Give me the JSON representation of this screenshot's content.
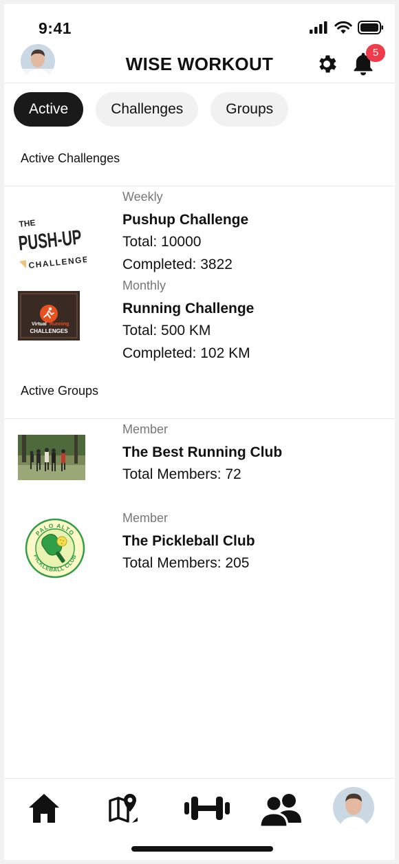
{
  "status_bar": {
    "time": "9:41"
  },
  "header": {
    "title": "WISE WORKOUT",
    "notification_count": "5"
  },
  "tabs": [
    {
      "label": "Active",
      "selected": true
    },
    {
      "label": "Challenges",
      "selected": false
    },
    {
      "label": "Groups",
      "selected": false
    }
  ],
  "active_challenges": {
    "heading": "Active Challenges",
    "items": [
      {
        "period": "Weekly",
        "name": "Pushup Challenge",
        "total": "Total: 10000",
        "completed": "Completed: 3822",
        "logo": {
          "top": "THE",
          "main": "PUSH-UP",
          "bottom": "CHALLENGE"
        }
      },
      {
        "period": "Monthly",
        "name": "Running Challenge",
        "total": "Total: 500 KM",
        "completed": "Completed: 102 KM",
        "logo": {
          "line1a": "Virtual",
          "line1b": "Running",
          "line2": "CHALLENGES"
        }
      }
    ]
  },
  "active_groups": {
    "heading": "Active Groups",
    "items": [
      {
        "role": "Member",
        "name": "The Best Running Club",
        "members": "Total Members: 72"
      },
      {
        "role": "Member",
        "name": "The Pickleball Club",
        "members": "Total Members: 205",
        "logo": {
          "top": "PALO ALTO",
          "bottom": "PICKLEBALL CLUB"
        }
      }
    ]
  },
  "bottom_nav": [
    "home-icon",
    "map-pin-icon",
    "dumbbell-icon",
    "groups-icon",
    "profile-avatar"
  ],
  "colors": {
    "accent_dark": "#1a1a1a",
    "badge_red": "#ef3b4a",
    "pickleball_green": "#2f9e44"
  }
}
